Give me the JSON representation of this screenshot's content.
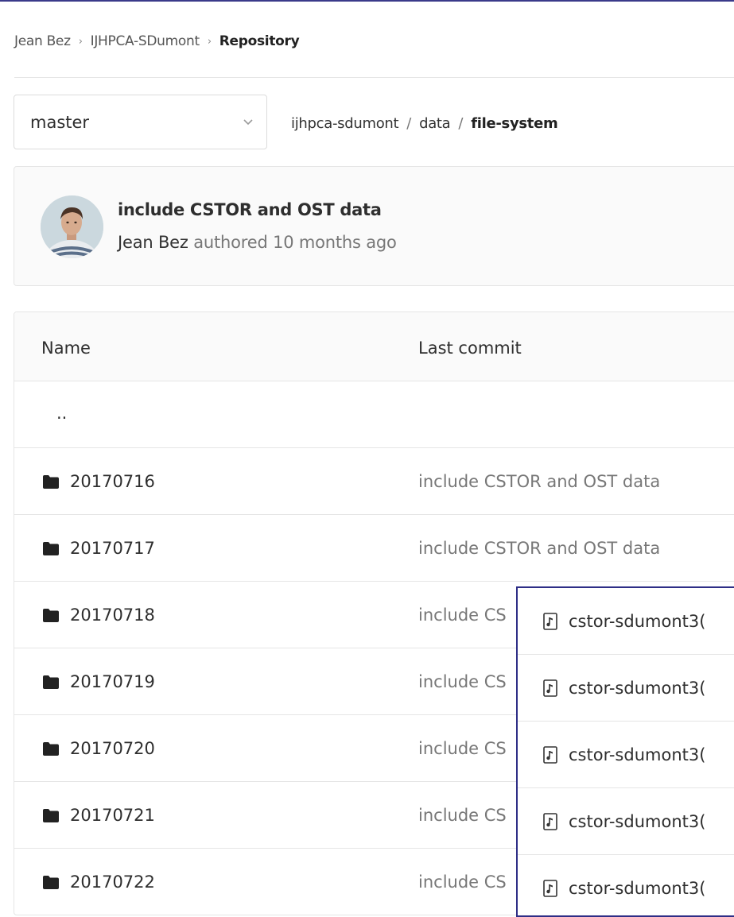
{
  "breadcrumb": {
    "items": [
      "Jean Bez",
      "IJHPCA-SDumont",
      "Repository"
    ]
  },
  "branch": {
    "selected": "master"
  },
  "path": {
    "segments": [
      "ijhpca-sdumont",
      "data",
      "file-system"
    ]
  },
  "commit": {
    "title": "include CSTOR and OST data",
    "author": "Jean Bez",
    "meta": "authored 10 months ago"
  },
  "tree": {
    "headers": {
      "name": "Name",
      "last_commit": "Last commit"
    },
    "updir": "..",
    "rows": [
      {
        "name": "20170716",
        "commit": "include CSTOR and OST data"
      },
      {
        "name": "20170717",
        "commit": "include CSTOR and OST data"
      },
      {
        "name": "20170718",
        "commit": "include CS"
      },
      {
        "name": "20170719",
        "commit": "include CS"
      },
      {
        "name": "20170720",
        "commit": "include CS"
      },
      {
        "name": "20170721",
        "commit": "include CS"
      },
      {
        "name": "20170722",
        "commit": "include CS"
      }
    ]
  },
  "overlay": {
    "items": [
      "cstor-sdumont3(",
      "cstor-sdumont3(",
      "cstor-sdumont3(",
      "cstor-sdumont3(",
      "cstor-sdumont3("
    ],
    "icon": "audio-file-icon"
  },
  "colors": {
    "overlay_border": "#2e2e86",
    "muted_text": "#777777"
  }
}
